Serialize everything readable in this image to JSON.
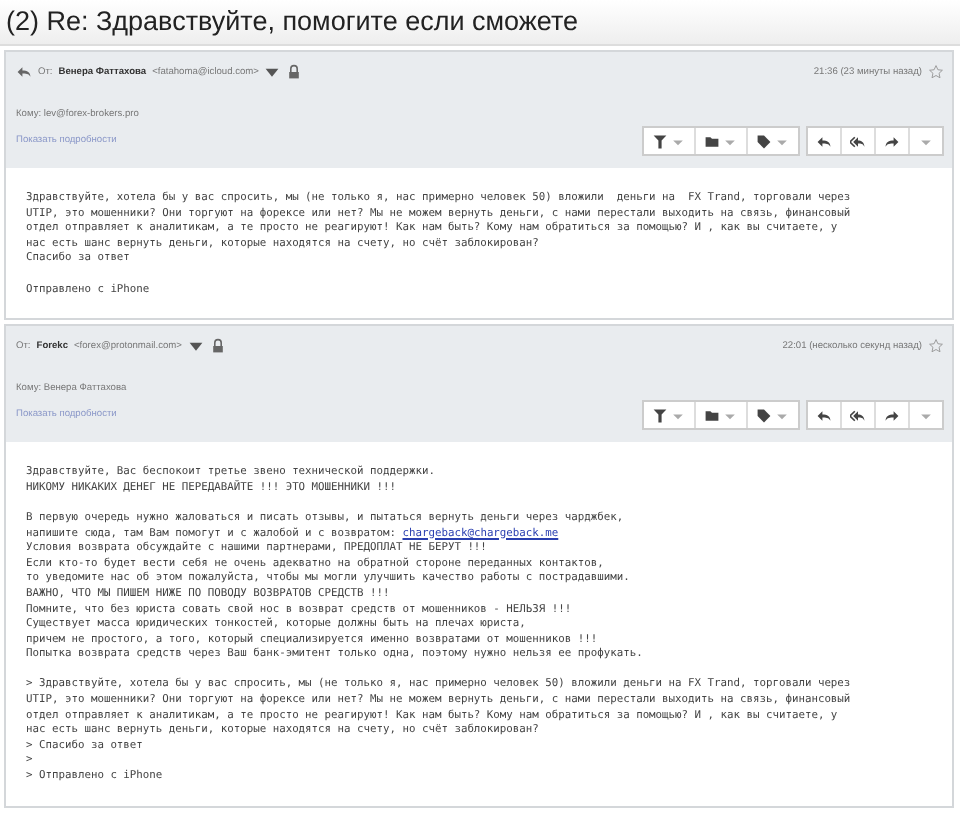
{
  "title": "(2) Re: Здравствуйте, помогите если сможете",
  "messages": [
    {
      "replied": true,
      "from_label": "От:",
      "sender": "Венера Фаттахова",
      "email": "<fatahoma@icloud.com>",
      "time": "21:36 (23 минуты назад)",
      "to": "Кому: lev@forex-brokers.pro",
      "details_link": "Показать подробности",
      "paragraphs": [
        {
          "text": "Здравствуйте, хотела бы у вас спросить, мы (не только я, нас примерно человек 50) вложили  деньги на  FX Trand, торговали через\nUTIP, это мошенники? Они торгуют на форексе или нет? Мы не можем вернуть деньги, с нами перестали выходить на связь, финансовый\nотдел отправляет к аналитикам, а те просто не реагируют! Как нам быть? Кому нам обратиться за помощью? И , как вы считаете, у\nнас есть шанс вернуть деньги, которые находятся на счету, но счёт заблокирован?\nСпасибо за ответ"
        },
        {
          "text": "Отправлено с iPhone"
        }
      ]
    },
    {
      "replied": false,
      "from_label": "От:",
      "sender": "Forekс",
      "email": "<forex@protonmail.com>",
      "time": "22:01 (несколько секунд назад)",
      "to": "Кому: Венера Фаттахова",
      "details_link": "Показать подробности",
      "paragraphs": [
        {
          "text": "Здравствуйте, Вас беспокоит третье звено технической поддержки.\nНИКОМУ НИКАКИХ ДЕНЕГ НЕ ПЕРЕДАВАЙТЕ !!! ЭТО МОШЕННИКИ !!!"
        },
        {
          "text": "В первую очередь нужно жаловаться и писать отзывы, и пытаться вернуть деньги через чарджбек,\nнапишите сюда, там Вам помогут и с жалобой и с возвратом: ",
          "link": "chargeback@chargeback.me",
          "after": "\nУсловия возврата обсуждайте с нашими партнерами, ПРЕДОПЛАТ НЕ БЕРУТ !!!\nЕсли кто-то будет вести себя не очень адекватно на обратной стороне переданных контактов,\nто уведомите нас об этом пожалуйста, чтобы мы могли улучшить качество работы с пострадавшими.\nВАЖНО, ЧТО МЫ ПИШЕМ НИЖЕ ПО ПОВОДУ ВОЗВРАТОВ СРЕДСТВ !!!\nПомните, что без юриста совать свой нос в возврат средств от мошенников - НЕЛЬЗЯ !!!\nСуществует масса юридических тонкостей, которые должны быть на плечах юриста,\nпричем не простого, а того, который специализируется именно возвратами от мошенников !!!\nПопытка возврата средств через Ваш банк-эмитент только одна, поэтому нужно нельзя ее профукать."
        },
        {
          "text": "> Здравствуйте, хотела бы у вас спросить, мы (не только я, нас примерно человек 50) вложили деньги на FX Trand, торговали через\nUTIP, это мошенники? Они торгуют на форексе или нет? Мы не можем вернуть деньги, с нами перестали выходить на связь, финансовый\nотдел отправляет к аналитикам, а те просто не реагируют! Как нам быть? Кому нам обратиться за помощью? И , как вы считаете, у\nнас есть шанс вернуть деньги, которые находятся на счету, но счёт заблокирован?\n> Спасибо за ответ\n>\n> Отправлено с iPhone"
        }
      ]
    }
  ]
}
